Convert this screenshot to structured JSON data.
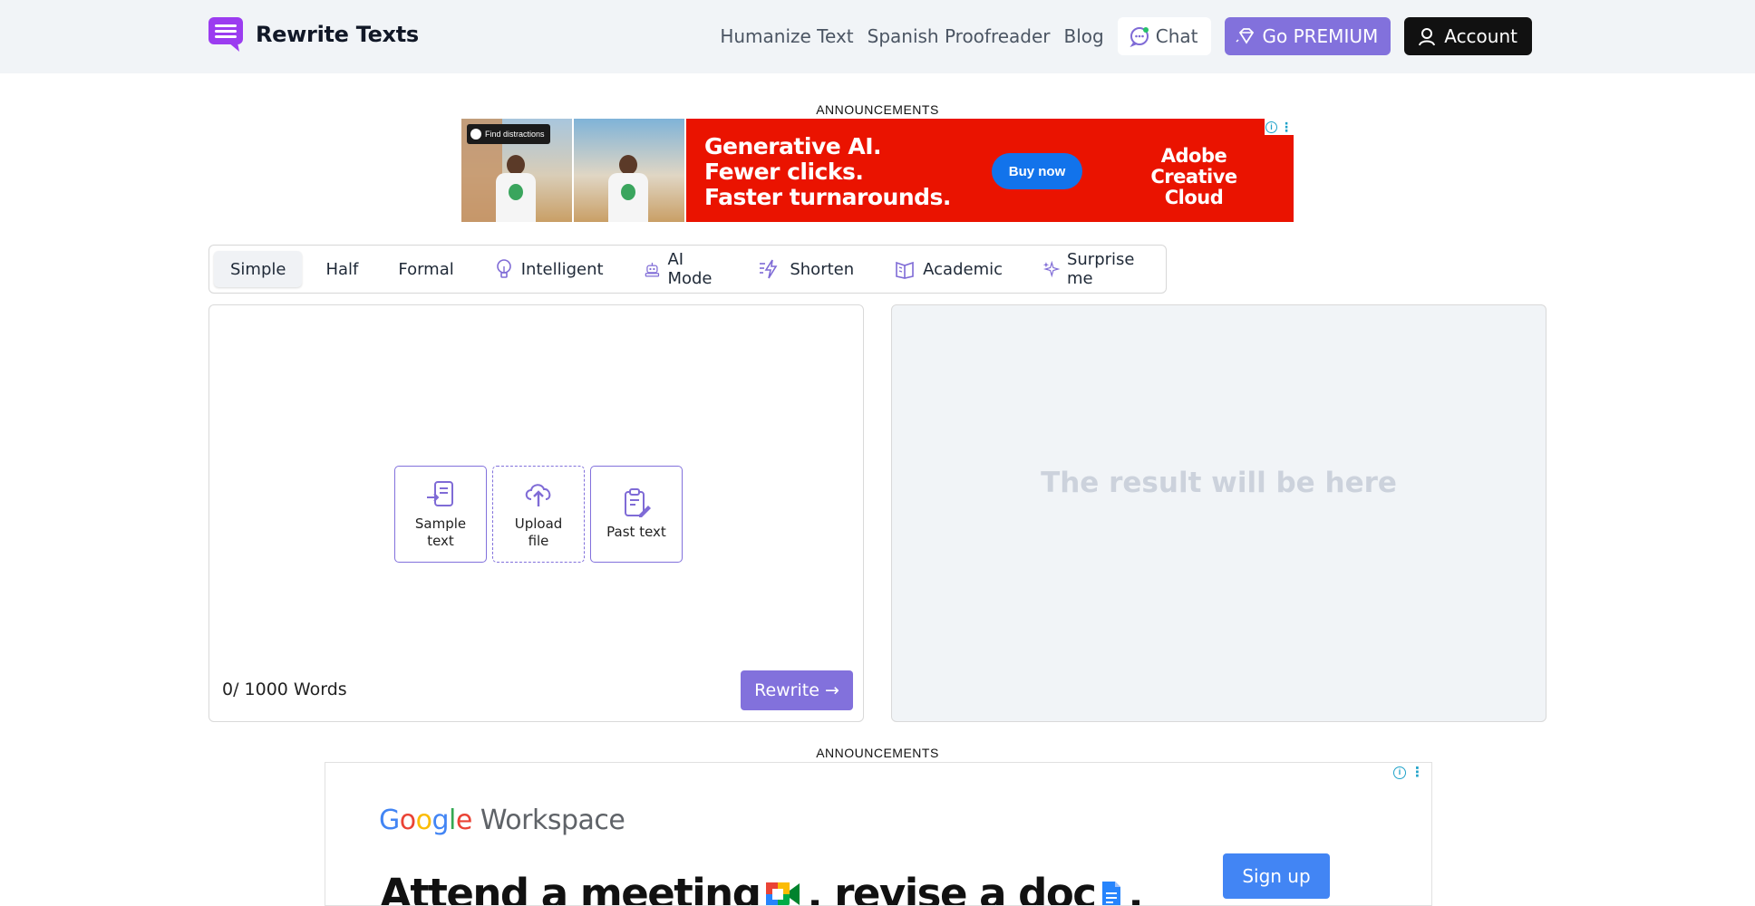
{
  "header": {
    "logo_text": "Rewrite Texts",
    "nav": {
      "humanize": "Humanize Text",
      "spanish": "Spanish Proofreader",
      "blog": "Blog",
      "chat": "Chat",
      "premium": "Go PREMIUM",
      "account": "Account"
    },
    "icons": {
      "logo": "chat-bubble-logo-icon",
      "chat": "chat-icon",
      "premium": "diamond-icon",
      "account": "user-icon"
    }
  },
  "announcements_label": "ANNOUNCEMENTS",
  "ad_top": {
    "tag": "Find distractions",
    "headline_1": "Generative AI.",
    "headline_2": "Fewer clicks.",
    "headline_3": "Faster turnarounds.",
    "cta": "Buy now",
    "brand_1": "Adobe",
    "brand_2": "Creative Cloud"
  },
  "modes": [
    {
      "label": "Simple",
      "icon": ""
    },
    {
      "label": "Half",
      "icon": ""
    },
    {
      "label": "Formal",
      "icon": ""
    },
    {
      "label": "Intelligent",
      "icon": "lightbulb-icon"
    },
    {
      "label": "AI Mode",
      "icon": "robot-icon"
    },
    {
      "label": "Shorten",
      "icon": "lightning-icon"
    },
    {
      "label": "Academic",
      "icon": "book-icon"
    },
    {
      "label": "Surprise me",
      "icon": "sparkle-icon"
    }
  ],
  "editor": {
    "sample_1": "Sample",
    "sample_2": "text",
    "upload_1": "Upload",
    "upload_2": "file",
    "paste": "Past text",
    "word_count": "0/ 1000 Words",
    "rewrite": "Rewrite →"
  },
  "output": {
    "placeholder": "The result will be here"
  },
  "ad_bottom": {
    "logo_g": "G",
    "logo_o1": "o",
    "logo_o2": "o",
    "logo_g2": "g",
    "logo_l": "l",
    "logo_e": "e",
    "logo_ws": "Workspace",
    "headline_a": "Attend a meeting",
    "headline_b": ", revise a doc",
    "headline_c": ",",
    "cta": "Sign up"
  },
  "colors": {
    "accent": "#8271dc",
    "header_bg": "#f1f4f7",
    "ad_red": "#ea1300"
  }
}
